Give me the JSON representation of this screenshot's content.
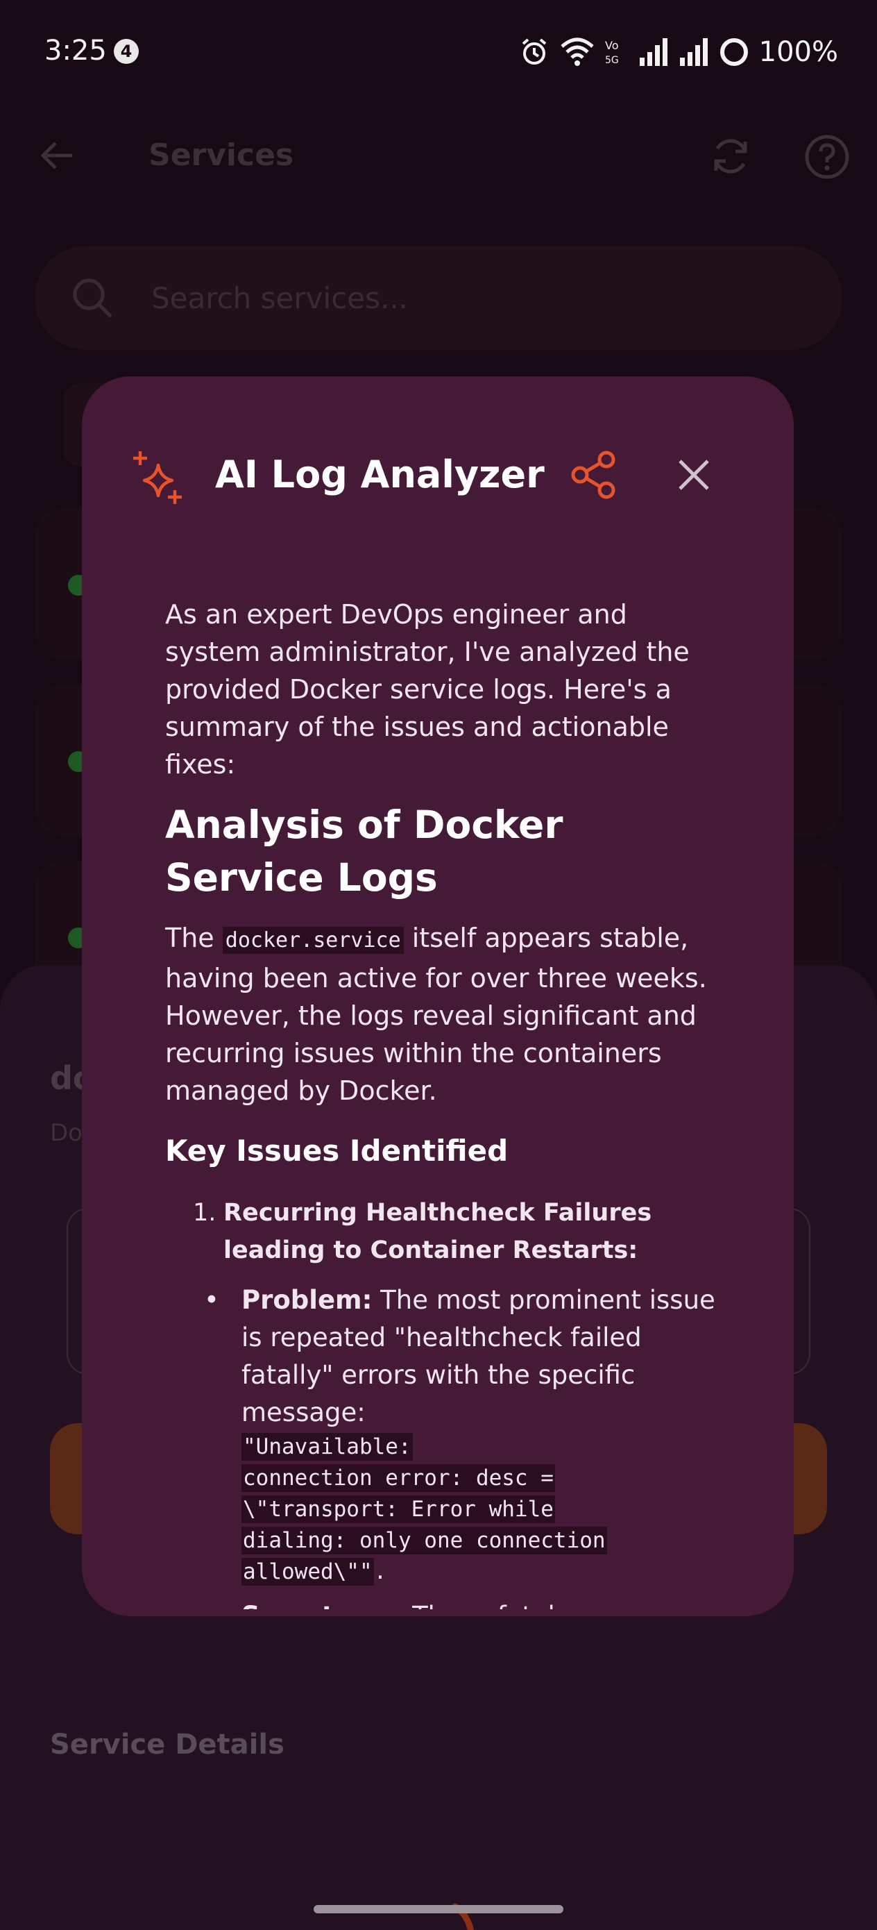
{
  "status_bar": {
    "time": "3:25",
    "notification_count": "4",
    "battery": "100%",
    "icons": [
      "alarm-icon",
      "wifi-icon",
      "volte-icon",
      "signal-icon",
      "signal-icon",
      "battery-ring-icon"
    ]
  },
  "app_bar": {
    "title": "Services",
    "icons": [
      "back-arrow-icon",
      "refresh-icon",
      "help-icon"
    ]
  },
  "search": {
    "placeholder": "Search services..."
  },
  "bottom_sheet": {
    "title_partial": "do",
    "subtitle_partial": "Do",
    "section_title": "Service Details"
  },
  "dialog": {
    "title": "AI Log Analyzer",
    "icons": [
      "sparkle-icon",
      "share-icon",
      "close-icon"
    ],
    "intro": "As an expert DevOps engineer and system administrator, I've analyzed the provided Docker service logs. Here's a summary of the issues and actionable fixes:",
    "heading": "Analysis of Docker Service Logs",
    "para_before": "The",
    "para_code": "docker.service",
    "para_after": "itself appears stable, having been active for over three weeks. However, the logs reveal significant and recurring issues within the containers managed by Docker.",
    "subheading": "Key Issues Identified",
    "list_number": "1.",
    "list_item": "Recurring Healthcheck Failures leading to Container Restarts:",
    "problem_label": "Problem:",
    "problem_text": "The most prominent issue is repeated \"healthcheck failed fatally\" errors with the specific message:",
    "problem_code_lines": [
      "\"Unavailable:",
      "connection error: desc =",
      "\\\"transport: Error while",
      "dialing: only one connection",
      "allowed\\\"\""
    ],
    "problem_end": ".",
    "symptoms_label": "Symptoms:",
    "symptoms_text": "These fatal"
  },
  "colors": {
    "accent": "#e8542a",
    "dialog_bg": "#441a36",
    "screen_bg": "#180a14"
  }
}
